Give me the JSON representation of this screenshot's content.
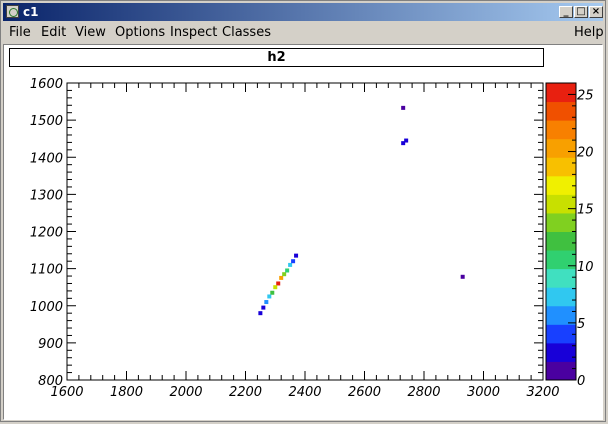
{
  "window": {
    "title": "c1"
  },
  "window_buttons": {
    "minimize": "_",
    "maximize": "□",
    "close": "×"
  },
  "menu": {
    "file": "File",
    "edit": "Edit",
    "view": "View",
    "options": "Options",
    "inspect": "Inspect",
    "classes": "Classes",
    "help": "Help"
  },
  "chart_data": {
    "type": "heatmap",
    "title": "h2",
    "xlim": [
      1600,
      3200
    ],
    "ylim": [
      800,
      1600
    ],
    "x_ticks": [
      "1600",
      "1800",
      "2000",
      "2200",
      "2400",
      "2600",
      "2800",
      "3000",
      "3200"
    ],
    "y_ticks": [
      "800",
      "900",
      "1000",
      "1100",
      "1200",
      "1300",
      "1400",
      "1500",
      "1600"
    ],
    "z_ticks": [
      "0",
      "5",
      "10",
      "15",
      "20",
      "25"
    ],
    "zlim": [
      0,
      26
    ],
    "palette": [
      "#4a00a0",
      "#1800d8",
      "#1840ff",
      "#2090ff",
      "#30c8f0",
      "#40e0c0",
      "#30d070",
      "#40c040",
      "#80d020",
      "#c8e000",
      "#f0f000",
      "#f8c000",
      "#f8a000",
      "#f88000",
      "#f05000",
      "#e82010"
    ],
    "cells": [
      {
        "x": 2310,
        "y": 1060,
        "z": 25
      },
      {
        "x": 2320,
        "y": 1075,
        "z": 20
      },
      {
        "x": 2300,
        "y": 1050,
        "z": 16
      },
      {
        "x": 2330,
        "y": 1085,
        "z": 14
      },
      {
        "x": 2290,
        "y": 1035,
        "z": 12
      },
      {
        "x": 2340,
        "y": 1095,
        "z": 10
      },
      {
        "x": 2280,
        "y": 1025,
        "z": 8
      },
      {
        "x": 2350,
        "y": 1110,
        "z": 7
      },
      {
        "x": 2270,
        "y": 1010,
        "z": 5
      },
      {
        "x": 2360,
        "y": 1120,
        "z": 4
      },
      {
        "x": 2260,
        "y": 995,
        "z": 3
      },
      {
        "x": 2370,
        "y": 1135,
        "z": 2
      },
      {
        "x": 2250,
        "y": 980,
        "z": 2
      },
      {
        "x": 2740,
        "y": 1445,
        "z": 3
      },
      {
        "x": 2730,
        "y": 1438,
        "z": 2
      },
      {
        "x": 2930,
        "y": 1078,
        "z": 1
      },
      {
        "x": 2730,
        "y": 1533,
        "z": 1
      }
    ]
  }
}
